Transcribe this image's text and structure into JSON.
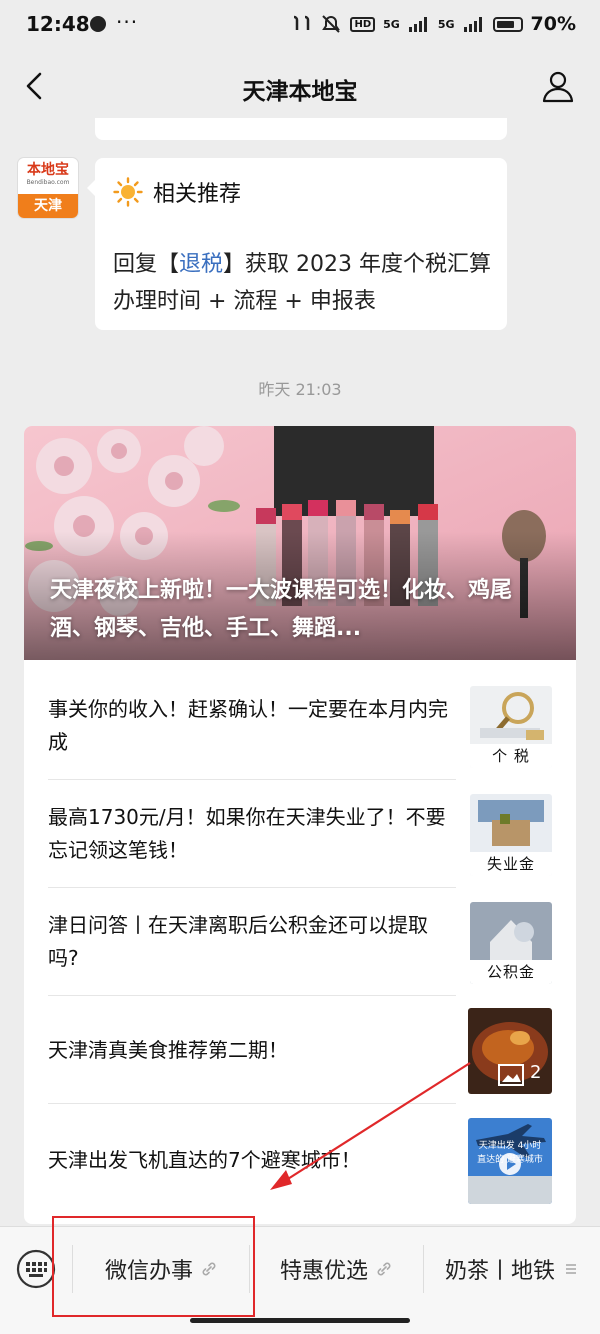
{
  "status_bar": {
    "time": "12:48",
    "more": "···",
    "network": "5G",
    "battery": "70%"
  },
  "header": {
    "title": "天津本地宝"
  },
  "avatar": {
    "logo": "本地宝",
    "logo_sub": "Bendibao.com",
    "city": "天津"
  },
  "recommend": {
    "title": "相关推荐",
    "reply_prefix": "回复【",
    "keyword": "退税",
    "reply_suffix": "】获取 2023 年度个税汇算办理时间 + 流程 + 申报表"
  },
  "timestamp": "昨天 21:03",
  "article_card": {
    "hero_title": "天津夜校上新啦！一大波课程可选！化妆、鸡尾酒、钢琴、吉他、手工、舞蹈...",
    "items": [
      {
        "title": "事关你的收入！赶紧确认！一定要在本月内完成",
        "thumb_label": "个 税"
      },
      {
        "title": "最高1730元/月！如果你在天津失业了！不要忘记领这笔钱！",
        "thumb_label": "失业金"
      },
      {
        "title": "津日问答丨在天津离职后公积金还可以提取吗?",
        "thumb_label": "公积金"
      },
      {
        "title": "天津清真美食推荐第二期！",
        "thumb_badge": "2"
      },
      {
        "title": "天津出发飞机直达的7个避寒城市！",
        "thumb_text_1": "天津出发 4小时",
        "thumb_text_2": "直达的 避寒城市"
      }
    ]
  },
  "bottom_menu": [
    {
      "label": "微信办事"
    },
    {
      "label": "特惠优选"
    },
    {
      "label": "奶茶丨地铁"
    }
  ],
  "colors": {
    "highlight": "#e0282a",
    "keyword": "#3a6fbf",
    "avatar_orange": "#f07e1b"
  }
}
